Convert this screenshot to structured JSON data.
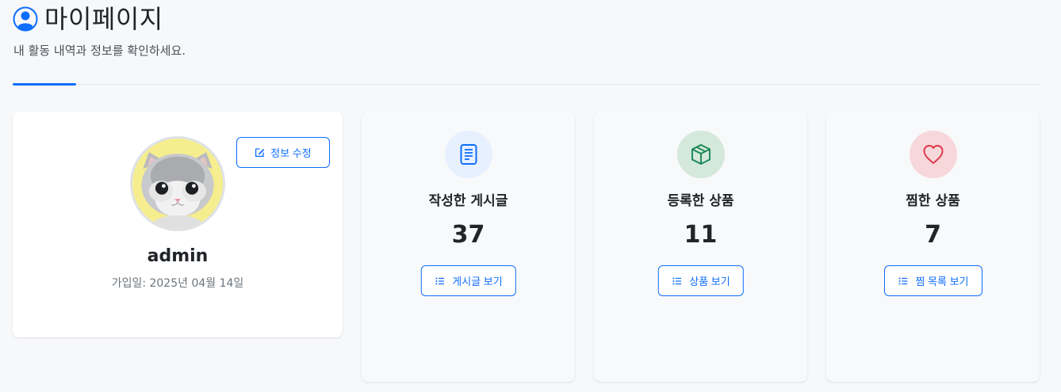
{
  "header": {
    "title": "마이페이지",
    "subtitle": "내 활동 내역과 정보를 확인하세요."
  },
  "profile": {
    "edit_label": "정보 수정",
    "username": "admin",
    "joined": "가입일: 2025년 04월 14일"
  },
  "stats": [
    {
      "title": "작성한 게시글",
      "value": "37",
      "button": "게시글 보기",
      "icon": "document-icon",
      "color": "#0d6efd",
      "bg": "#e7f0ff"
    },
    {
      "title": "등록한 상품",
      "value": "11",
      "button": "상품 보기",
      "icon": "box-icon",
      "color": "#198754",
      "bg": "#d4e8dc"
    },
    {
      "title": "찜한 상품",
      "value": "7",
      "button": "찜 목록 보기",
      "icon": "heart-icon",
      "color": "#dc3545",
      "bg": "#f8d7da"
    }
  ],
  "colors": {
    "accent": "#0d6efd"
  }
}
